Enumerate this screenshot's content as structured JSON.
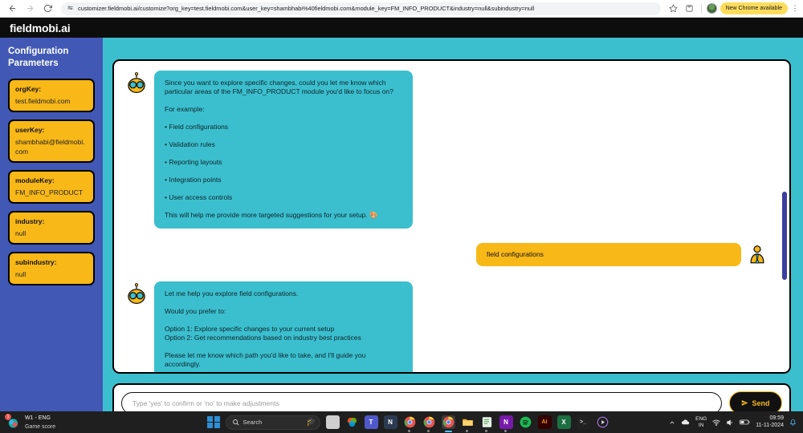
{
  "browser": {
    "back_icon": "back-arrow-icon",
    "forward_icon": "forward-arrow-icon",
    "reload_icon": "reload-icon",
    "url": "customizer.fieldmobi.ai/customize?org_key=test.fieldmobi.com&user_key=shambhabi%40fieldmobi.com&module_key=FM_INFO_PRODUCT&industry=null&subindustry=null",
    "bookmark_icon": "star-icon",
    "extensions_icon": "extensions-icon",
    "profile_icon": "profile-avatar",
    "update_pill": "New Chrome available",
    "menu_icon": "kebab-menu-icon"
  },
  "app": {
    "brand": "fieldmobi.ai",
    "accent_teal": "#3bbfce",
    "accent_yellow": "#f8b817",
    "sidebar_blue": "#4158b5"
  },
  "sidebar": {
    "title": "Configuration Parameters",
    "cards": [
      {
        "key": "orgKey:",
        "value": "test.fieldmobi.com"
      },
      {
        "key": "userKey:",
        "value": "shambhabi@fieldmobi.com"
      },
      {
        "key": "moduleKey:",
        "value": "FM_INFO_PRODUCT"
      },
      {
        "key": "industry:",
        "value": "null"
      },
      {
        "key": "subindustry:",
        "value": "null"
      }
    ]
  },
  "chat": {
    "messages": [
      {
        "role": "bot",
        "avatar": "robot-avatar",
        "lines": [
          "Since you want to explore specific changes, could you let me know which particular areas of the FM_INFO_PRODUCT module you'd like to focus on?",
          "For example:",
          "• Field configurations",
          "• Validation rules",
          "• Reporting layouts",
          "• Integration points",
          "• User access controls",
          "This will help me provide more targeted suggestions for your setup. 🎨"
        ]
      },
      {
        "role": "user",
        "avatar": "user-avatar",
        "text": "field configurations"
      },
      {
        "role": "bot",
        "avatar": "robot-avatar",
        "lines": [
          "Let me help you explore field configurations.",
          "Would you prefer to:",
          "Option 1: Explore specific changes to your current setup",
          "Option 2: Get recommendations based on industry best practices",
          "Please let me know which path you'd like to take, and I'll guide you accordingly."
        ]
      },
      {
        "role": "user",
        "avatar": "user-avatar",
        "text": ""
      }
    ]
  },
  "composer": {
    "placeholder": "Type 'yes' to confirm or 'no' to make adjustments",
    "value": "",
    "send_label": "Send",
    "send_icon": "paper-plane-icon"
  },
  "taskbar": {
    "left_title": "W1 - ENG",
    "left_subtitle": "Game score",
    "left_badge": "1",
    "start_icon": "windows-start-icon",
    "search_placeholder": "Search",
    "search_icon": "search-icon",
    "apps": [
      {
        "name": "task-view-icon",
        "glyph": ""
      },
      {
        "name": "copilot-icon",
        "glyph": ""
      },
      {
        "name": "microsoft-teams-icon",
        "glyph": ""
      },
      {
        "name": "notion-icon",
        "glyph": "N"
      },
      {
        "name": "chrome-icon-1",
        "glyph": ""
      },
      {
        "name": "chrome-icon-2",
        "glyph": ""
      },
      {
        "name": "chrome-icon-3",
        "glyph": ""
      },
      {
        "name": "file-explorer-icon",
        "glyph": ""
      },
      {
        "name": "notepad-icon",
        "glyph": ""
      },
      {
        "name": "onenote-icon",
        "glyph": "N"
      },
      {
        "name": "spotify-icon",
        "glyph": ""
      },
      {
        "name": "illustrator-icon",
        "glyph": "Ai"
      },
      {
        "name": "excel-icon",
        "glyph": "X"
      },
      {
        "name": "terminal-icon",
        "glyph": ">_"
      },
      {
        "name": "media-player-icon",
        "glyph": "▶"
      }
    ],
    "tray": {
      "chevron_icon": "chevron-up-icon",
      "cloud_icon": "onedrive-icon",
      "language_line1": "ENG",
      "language_line2": "IN",
      "wifi_icon": "wifi-icon",
      "volume_icon": "speaker-icon",
      "battery_icon": "battery-icon",
      "time": "09:59",
      "date": "11-11-2024",
      "notification_icon": "bell-icon"
    }
  }
}
